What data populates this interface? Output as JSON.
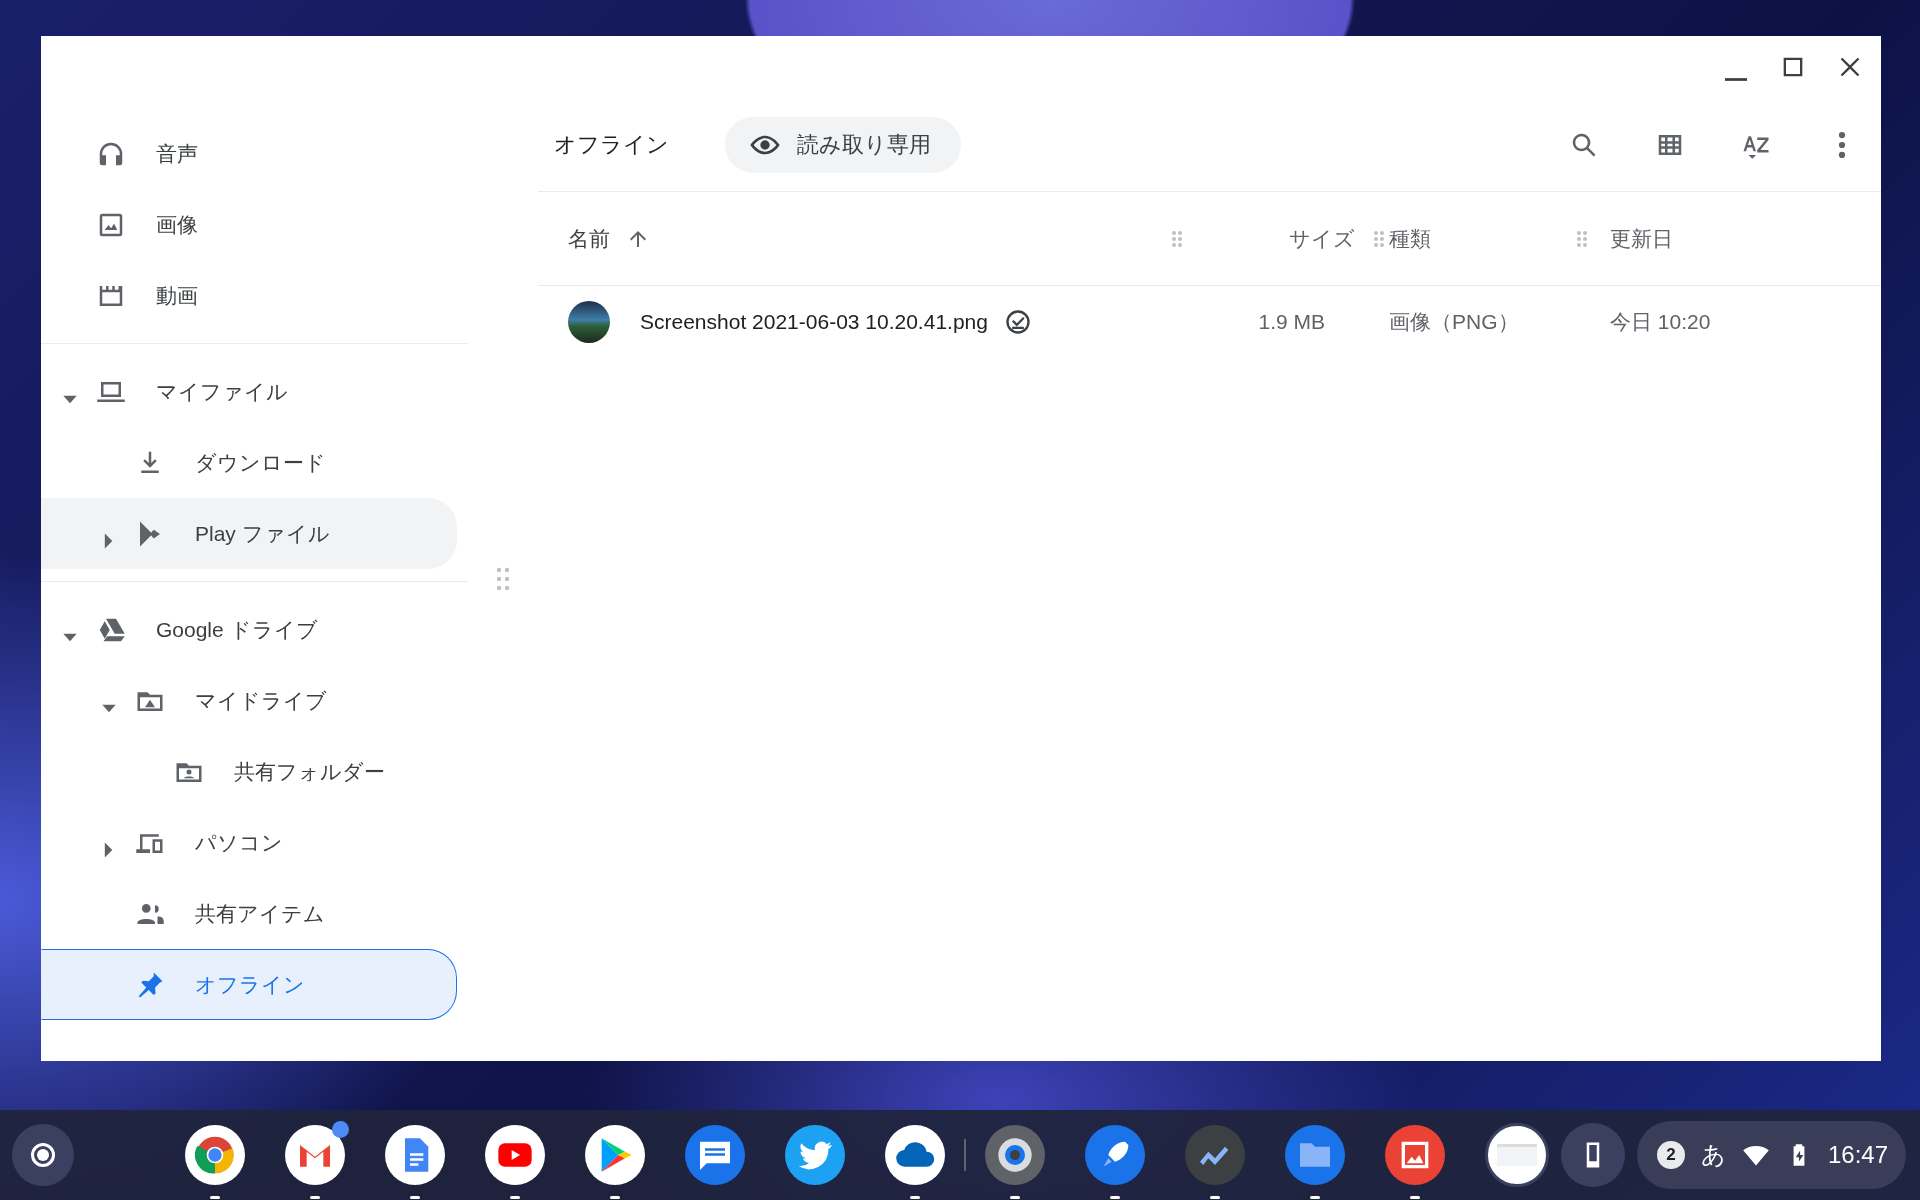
{
  "sidebar": {
    "sections": [
      {
        "items": [
          {
            "label": "音声",
            "selected": false,
            "hovered": false
          },
          {
            "label": "画像",
            "selected": false,
            "hovered": false
          },
          {
            "label": "動画",
            "selected": false,
            "hovered": false
          }
        ]
      },
      {
        "items": [
          {
            "label": "マイファイル",
            "selected": false,
            "hovered": false,
            "expanded": true,
            "children": [
              {
                "label": "ダウンロード",
                "selected": false,
                "hovered": false
              },
              {
                "label": "Play ファイル",
                "selected": false,
                "hovered": true,
                "expanded": false
              }
            ]
          }
        ]
      },
      {
        "items": [
          {
            "label": "Google ドライブ",
            "selected": false,
            "hovered": false,
            "expanded": true,
            "children": [
              {
                "label": "マイドライブ",
                "selected": false,
                "hovered": false,
                "expanded": true,
                "children": [
                  {
                    "label": "共有フォルダー",
                    "selected": false,
                    "hovered": false
                  }
                ]
              },
              {
                "label": "パソコン",
                "selected": false,
                "hovered": false,
                "expanded": false
              },
              {
                "label": "共有アイテム",
                "selected": false,
                "hovered": false
              },
              {
                "label": "オフライン",
                "selected": true,
                "hovered": false
              }
            ]
          }
        ]
      }
    ]
  },
  "toolbar": {
    "title": "オフライン",
    "chip": "読み取り専用"
  },
  "table": {
    "columns": [
      {
        "label": "名前",
        "sorted": true
      },
      {
        "label": "サイズ",
        "sorted": false
      },
      {
        "label": "種類",
        "sorted": false
      },
      {
        "label": "更新日",
        "sorted": false
      }
    ],
    "rows": [
      {
        "name": "Screenshot 2021-06-03 10.20.41.png",
        "available_offline": true,
        "size": "1.9 MB",
        "type": "画像（PNG）",
        "modified": "今日 10:20",
        "selected": false
      }
    ]
  },
  "shelf": {
    "apps": [
      {
        "running": true,
        "notification": false
      },
      {
        "running": true,
        "notification": true
      },
      {
        "running": true,
        "notification": false
      },
      {
        "running": true,
        "notification": false
      },
      {
        "running": true,
        "notification": false
      },
      {
        "running": false,
        "notification": false
      },
      {
        "running": false,
        "notification": false
      },
      {
        "running": true,
        "notification": false
      },
      {
        "running": true,
        "notification": false
      },
      {
        "running": true,
        "notification": false
      },
      {
        "running": true,
        "notification": false
      },
      {
        "running": true,
        "notification": false
      },
      {
        "running": true,
        "notification": false
      }
    ],
    "notification_count": "2",
    "ime": "あ",
    "time": "16:47"
  }
}
